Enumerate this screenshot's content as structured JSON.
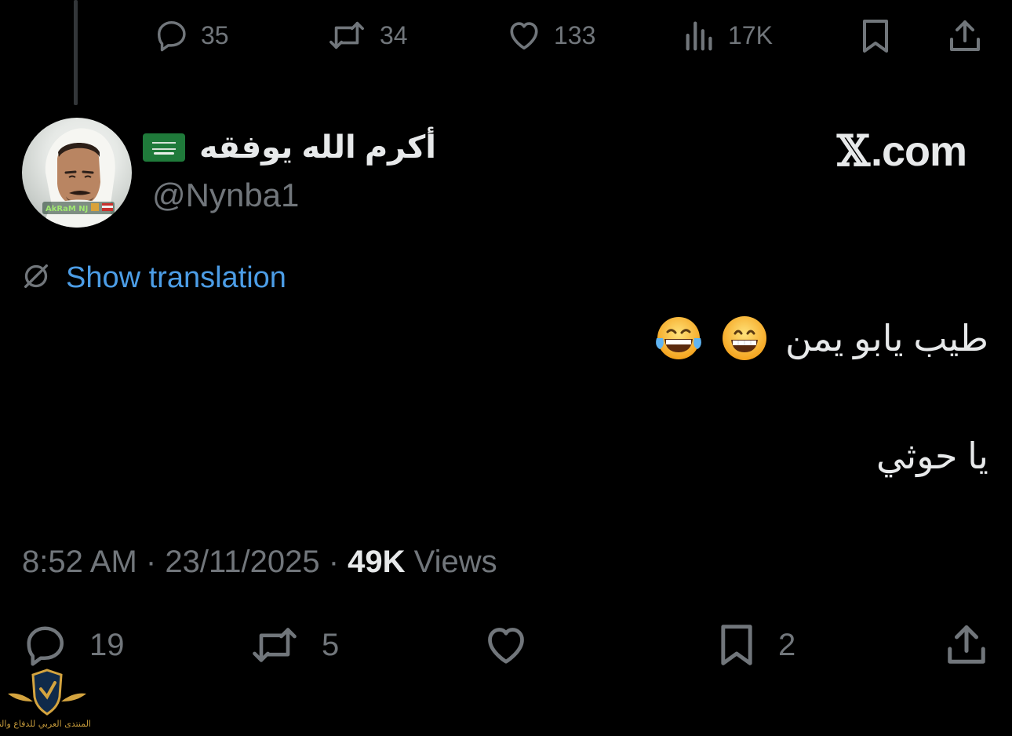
{
  "previous_tweet": {
    "stats": {
      "replies": "35",
      "reposts": "34",
      "likes": "133",
      "views": "17K"
    }
  },
  "author": {
    "display_name": "أكرم الله يوفقه",
    "handle": "@Nynba1",
    "avatar_caption": "AkRaM NJ"
  },
  "brand": {
    "domain": ".com"
  },
  "translate": {
    "label": "Show translation"
  },
  "tweet": {
    "line1": "طيب يابو يمن",
    "line2": "يا حوثي"
  },
  "meta": {
    "time": "8:52 AM",
    "date": "23/11/2025",
    "views_count": "49K",
    "views_label": "Views",
    "separator": "·"
  },
  "actions": {
    "replies": "19",
    "reposts": "5",
    "bookmarks": "2"
  },
  "colors": {
    "background": "#000000",
    "text_primary": "#e7e9ea",
    "text_secondary": "#71767b",
    "link": "#4c9de6",
    "flag_green": "#1f7a3a"
  },
  "icons": {
    "reply": "reply-icon",
    "repost": "repost-icon",
    "like": "heart-icon",
    "views": "analytics-icon",
    "bookmark": "bookmark-icon",
    "share": "share-icon",
    "translate": "translate-icon"
  },
  "watermark": {
    "text": "المنتدى العربي للدفاع والتسليح"
  }
}
